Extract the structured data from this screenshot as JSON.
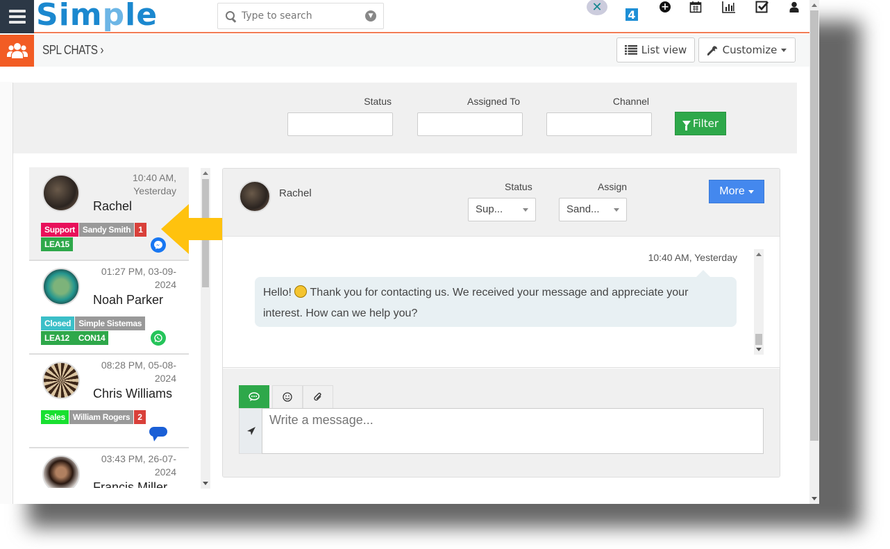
{
  "app": {
    "logo_text": "Simple",
    "logo_o": "p"
  },
  "search": {
    "placeholder": "Type to search"
  },
  "top_icons": [
    "x-app-icon",
    "four-app-icon",
    "plus-circle-icon",
    "calendar-icon",
    "bar-chart-icon",
    "checkbox-icon",
    "user-icon"
  ],
  "breadcrumb": {
    "title": "SPL CHATS",
    "chevron": "›"
  },
  "toolbar": {
    "list_view_label": "List view",
    "customize_label": "Customize"
  },
  "filters": {
    "status_label": "Status",
    "assigned_label": "Assigned To",
    "channel_label": "Channel",
    "status_value": "",
    "assigned_value": "",
    "channel_value": "",
    "filter_button": "Filter"
  },
  "chats": [
    {
      "time_line1": "10:40 AM,",
      "time_line2": "Yesterday",
      "name": "Rachel",
      "tags": [
        {
          "text": "Support",
          "color": "#e8105a"
        },
        {
          "text": "Sandy Smith",
          "color": "#999999"
        },
        {
          "text": "1",
          "color": "#d9403a"
        },
        {
          "text": "LEA15",
          "color": "#2ea84a"
        }
      ],
      "channel": "messenger-icon",
      "channel_color": "#1877f2"
    },
    {
      "time_line1": "01:27 PM, 03-09-",
      "time_line2": "2024",
      "name": "Noah Parker",
      "tags": [
        {
          "text": "Closed",
          "color": "#3bbfc8"
        },
        {
          "text": "Simple Sistemas",
          "color": "#999999"
        },
        {
          "text": "LEA12",
          "color": "#2ea84a"
        },
        {
          "text": "CON14",
          "color": "#2ea84a"
        }
      ],
      "channel": "whatsapp-icon",
      "channel_color": "#25c45a"
    },
    {
      "time_line1": "08:28 PM, 05-08-",
      "time_line2": "2024",
      "name": "Chris Williams",
      "tags": [
        {
          "text": "Sales",
          "color": "#18e030"
        },
        {
          "text": "William Rogers",
          "color": "#999999"
        },
        {
          "text": "2",
          "color": "#d9403a"
        }
      ],
      "channel": "sms-bubble-icon",
      "channel_color": "#1a5fd6"
    },
    {
      "time_line1": "03:43 PM, 26-07-",
      "time_line2": "2024",
      "name": "Francis Miller",
      "tags": [],
      "channel": "",
      "channel_color": ""
    }
  ],
  "conversation": {
    "contact_name": "Rachel",
    "status_label": "Status",
    "status_value": "Sup...",
    "assign_label": "Assign",
    "assign_value": "Sand...",
    "more_button": "More",
    "messages": [
      {
        "time": "10:40 AM, Yesterday",
        "text_before_emoji": "Hello! ",
        "text_after_emoji": " Thank you for contacting us. We received your message and appreciate your interest. How can we help you?"
      }
    ],
    "compose": {
      "tabs": [
        "chat-icon",
        "smiley-icon",
        "paperclip-icon"
      ],
      "placeholder": "Write a message..."
    }
  },
  "colors": {
    "brand": "#1b88cf",
    "accent_orange": "#f25c24",
    "nav_dark": "#2c3846",
    "filter_green": "#2ea84a",
    "more_blue": "#4488ee",
    "arrow_yellow": "#ffc20e"
  }
}
